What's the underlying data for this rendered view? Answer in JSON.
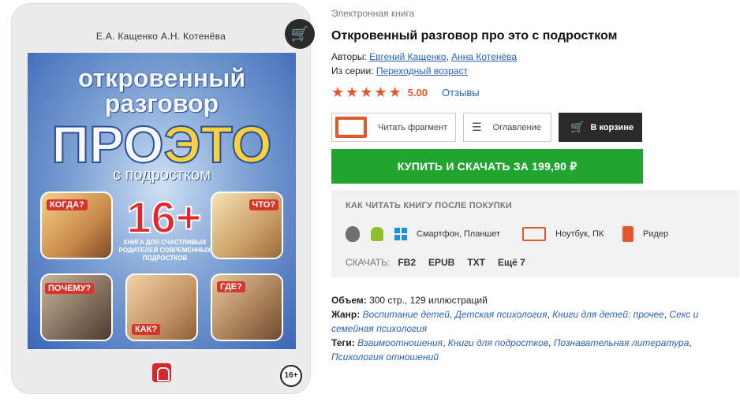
{
  "cover": {
    "authors": "Е.А. Кащенко  А.Н. Котенёва",
    "line1": "откровенный",
    "line2": "разговор",
    "big_pro": "ПРО",
    "big_eto": "ЭТО",
    "subtitle": "с подростком",
    "age_big": "16+",
    "tagline": "КНИГА ДЛЯ СЧАСТЛИВЫХ РОДИТЕЛЕЙ СОВРЕМЕННЫХ ПОДРОСТКОВ",
    "tiles": [
      "КОГДА?",
      "ЧТО?",
      "ПОЧЕМУ?",
      "КАК?",
      "ГДЕ?"
    ],
    "age_badge": "16+"
  },
  "product": {
    "type": "Электронная книга",
    "title": "Откровенный разговор про это с подростком",
    "authors_label": "Авторы:",
    "author1": "Евгений Кащенко",
    "sep": ",",
    "author2": "Анна Котенёва",
    "series_label": "Из серии:",
    "series": "Переходный возраст",
    "rating": "5.00",
    "stars": 5,
    "reviews": "Отзывы"
  },
  "buttons": {
    "read_fragment": "Читать фрагмент",
    "toc": "Оглавление",
    "in_cart": "В корзине",
    "buy": "КУПИТЬ И СКАЧАТЬ ЗА 199,90 ₽"
  },
  "howto": {
    "title": "КАК ЧИТАТЬ КНИГУ ПОСЛЕ ПОКУПКИ",
    "dev_phone": "Смартфон, Планшет",
    "dev_laptop": "Ноутбук, ПК",
    "dev_reader": "Ридер",
    "download_label": "СКАЧАТЬ:",
    "formats": [
      "FB2",
      "EPUB",
      "TXT",
      "Ещё 7"
    ]
  },
  "details": {
    "volume_label": "Объем:",
    "volume": " 300 стр., 129 иллюстраций",
    "genre_label": "Жанр:",
    "genres": [
      "Воспитание детей",
      "Детская психология",
      "Книги для детей: прочее",
      "Секс и семейная психология"
    ],
    "tags_label": "Теги:",
    "tags": [
      "Взаимоотношения",
      "Книги для подростков",
      "Познавательная литература",
      "Психология отношений"
    ]
  },
  "colors": {
    "accent_orange": "#e8542a",
    "buy_green": "#22a430",
    "link_blue": "#2b62b8",
    "dark": "#2a2a2a"
  }
}
